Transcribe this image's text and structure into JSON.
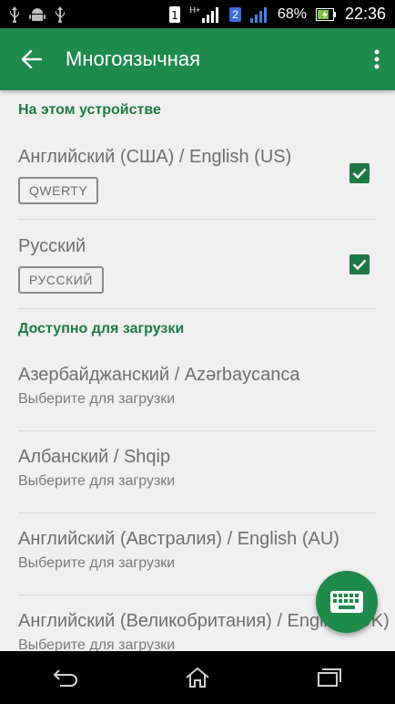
{
  "status": {
    "network_label": "H+",
    "sim_label": "2",
    "battery": "68%",
    "time": "22:36"
  },
  "appbar": {
    "title": "Многоязычная"
  },
  "sections": {
    "on_device": "На этом устройстве",
    "available": "Доступно для загрузки"
  },
  "enabled_languages": [
    {
      "name": "Английский (США) / English (US)",
      "layout": "QWERTY",
      "checked": true
    },
    {
      "name": "Русский",
      "layout": "РУССКИЙ",
      "checked": true
    }
  ],
  "available_languages": [
    {
      "name": "Азербайджанский / Azərbaycanca",
      "action": "Выберите для загрузки"
    },
    {
      "name": "Албанский / Shqip",
      "action": "Выберите для загрузки"
    },
    {
      "name": "Английский (Австралия) / English (AU)",
      "action": "Выберите для загрузки"
    },
    {
      "name": "Английский (Великобритания) / English (UK)",
      "action": "Выберите для загрузки"
    }
  ],
  "colors": {
    "accent": "#1e8a4c",
    "accent_dark": "#1e7a45"
  },
  "icons": {
    "back": "arrow-left-icon",
    "more": "more-vert-icon",
    "fab": "keyboard-icon"
  }
}
